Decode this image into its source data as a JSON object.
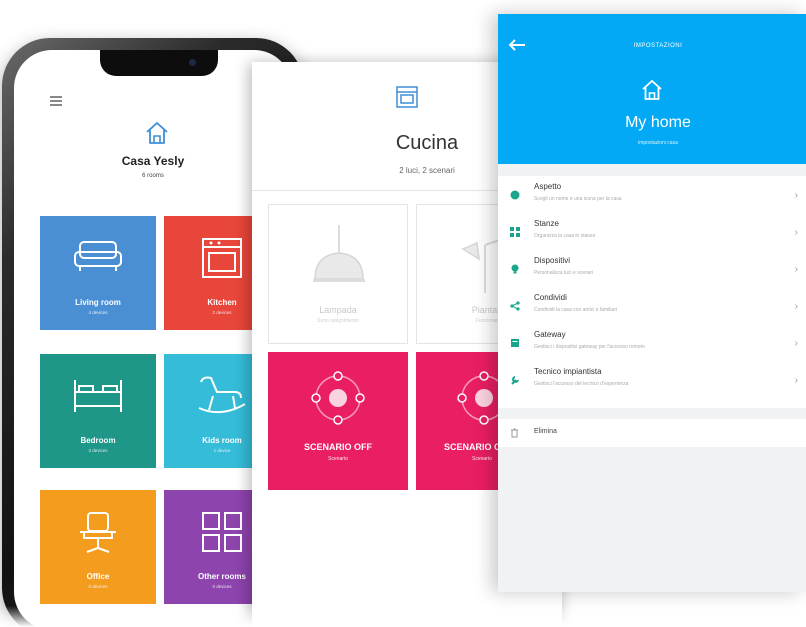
{
  "phone": {
    "house_name": "Casa Yesly",
    "rooms_count": "6 rooms",
    "tiles": [
      {
        "name": "Living room",
        "devices": "4 devices",
        "color": "#4a8fd4",
        "icon": "sofa-icon"
      },
      {
        "name": "Kitchen",
        "devices": "2 devices",
        "color": "#e8463a",
        "icon": "oven-icon"
      },
      {
        "name": "Bedroom",
        "devices": "3 devices",
        "color": "#1e9688",
        "icon": "bed-icon"
      },
      {
        "name": "Kids room",
        "devices": "1 device",
        "color": "#35bcd8",
        "icon": "rocking-horse-icon"
      },
      {
        "name": "Office",
        "devices": "0 devices",
        "color": "#f39c1e",
        "icon": "office-chair-icon"
      },
      {
        "name": "Other rooms",
        "devices": "0 devices",
        "color": "#8e44ad",
        "icon": "grid-icon"
      }
    ]
  },
  "room": {
    "title": "Cucina",
    "subtitle": "2 luci, 2 scenari",
    "devices": [
      {
        "name": "Lampada",
        "state": "Sono spegnimento",
        "icon": "pendant-lamp-icon"
      },
      {
        "name": "Piantana",
        "state": "Funzionante",
        "icon": "floor-lamp-icon"
      }
    ],
    "scenarios": [
      {
        "name": "SCENARIO OFF",
        "type": "Scenario"
      },
      {
        "name": "SCENARIO ON",
        "type": "Scenario"
      }
    ],
    "accent": "#e91e63"
  },
  "settings": {
    "header_label": "IMPOSTAZIONI",
    "title": "My home",
    "subtitle": "impostazioni casa",
    "accent": "#03a9f4",
    "items": [
      {
        "title": "Aspetto",
        "desc": "Scegli un nome e una icona per la casa",
        "icon": "palette-icon",
        "icon_color": "#1aa58d"
      },
      {
        "title": "Stanze",
        "desc": "Organizza la casa in stanze",
        "icon": "grid-icon",
        "icon_color": "#1aa58d"
      },
      {
        "title": "Dispositivi",
        "desc": "Personalizza luci e scenari",
        "icon": "bulb-icon",
        "icon_color": "#1aa58d"
      },
      {
        "title": "Condividi",
        "desc": "Condividi la casa con amici e familiari",
        "icon": "share-icon",
        "icon_color": "#1aa58d"
      },
      {
        "title": "Gateway",
        "desc": "Gestisci i dispositivi gateway per l'accesso remoto",
        "icon": "gateway-icon",
        "icon_color": "#1aa58d"
      },
      {
        "title": "Tecnico impiantista",
        "desc": "Gestisci l'accesso del tecnico d'esperienza",
        "icon": "wrench-icon",
        "icon_color": "#1aa58d"
      }
    ],
    "delete_label": "Elimina",
    "chevron": "›"
  }
}
